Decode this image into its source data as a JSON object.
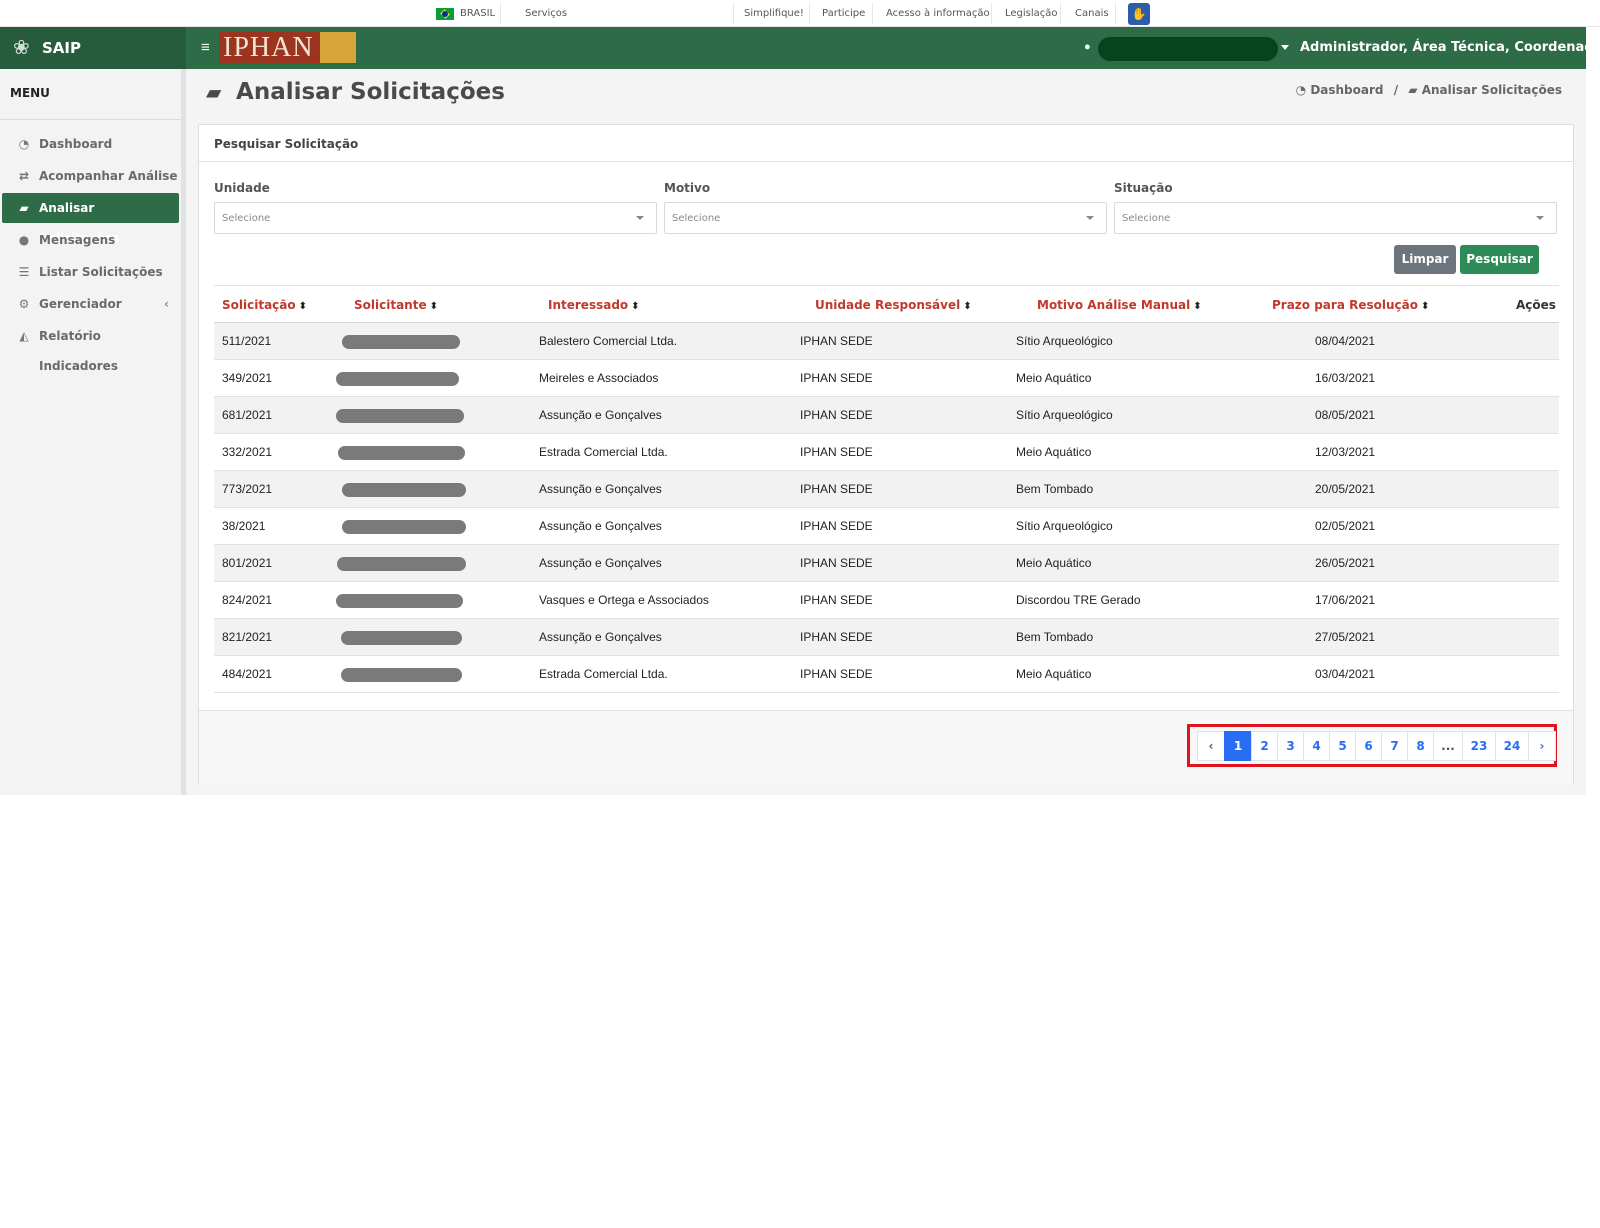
{
  "gov_bar": {
    "brasil": "BRASIL",
    "servicos": "Serviços",
    "links": [
      "Simplifique!",
      "Participe",
      "Acesso à informação",
      "Legislação",
      "Canais"
    ]
  },
  "header": {
    "app_name": "SAIP",
    "logo_text": "IPHAN",
    "user_role": "Administrador, Área Técnica, Coordenação..."
  },
  "sidebar": {
    "title": "MENU",
    "items": [
      {
        "label": "Dashboard",
        "icon": "dashboard-icon"
      },
      {
        "label": "Acompanhar Análise",
        "icon": "exchange-icon"
      },
      {
        "label": "Analisar Solicitações",
        "icon": "book-icon"
      },
      {
        "label": "Mensagens",
        "icon": "comments-icon"
      },
      {
        "label": "Listar Solicitações",
        "icon": "list-icon"
      },
      {
        "label": "Gerenciador",
        "icon": "cogs-icon"
      },
      {
        "label": "Relatório Indicadores",
        "icon": "area-chart-icon"
      }
    ],
    "active_index": 2
  },
  "page": {
    "title": "Analisar Solicitações",
    "breadcrumb": [
      "Dashboard",
      "Analisar Solicitações"
    ]
  },
  "search": {
    "panel_title": "Pesquisar Solicitação",
    "fields": [
      {
        "label": "Unidade",
        "placeholder": "Selecione"
      },
      {
        "label": "Motivo",
        "placeholder": "Selecione"
      },
      {
        "label": "Situação",
        "placeholder": "Selecione"
      }
    ],
    "clear_label": "Limpar",
    "search_label": "Pesquisar"
  },
  "table": {
    "columns": [
      "Solicitação",
      "Solicitante",
      "Interessado",
      "Unidade Responsável",
      "Motivo Análise Manual",
      "Prazo para Resolução",
      "Ações"
    ],
    "rows": [
      {
        "solicitacao": "511/2021",
        "interessado": "Balestero Comercial Ltda.",
        "unidade": "IPHAN SEDE",
        "motivo": "Sítio Arqueológico",
        "prazo": "08/04/2021"
      },
      {
        "solicitacao": "349/2021",
        "interessado": "Meireles e Associados",
        "unidade": "IPHAN SEDE",
        "motivo": "Meio Aquático",
        "prazo": "16/03/2021"
      },
      {
        "solicitacao": "681/2021",
        "interessado": "Assunção e Gonçalves",
        "unidade": "IPHAN SEDE",
        "motivo": "Sítio Arqueológico",
        "prazo": "08/05/2021"
      },
      {
        "solicitacao": "332/2021",
        "interessado": "Estrada Comercial Ltda.",
        "unidade": "IPHAN SEDE",
        "motivo": "Meio Aquático",
        "prazo": "12/03/2021"
      },
      {
        "solicitacao": "773/2021",
        "interessado": "Assunção e Gonçalves",
        "unidade": "IPHAN SEDE",
        "motivo": "Bem Tombado",
        "prazo": "20/05/2021"
      },
      {
        "solicitacao": "38/2021",
        "interessado": "Assunção e Gonçalves",
        "unidade": "IPHAN SEDE",
        "motivo": "Sítio Arqueológico",
        "prazo": "02/05/2021"
      },
      {
        "solicitacao": "801/2021",
        "interessado": "Assunção e Gonçalves",
        "unidade": "IPHAN SEDE",
        "motivo": "Meio Aquático",
        "prazo": "26/05/2021"
      },
      {
        "solicitacao": "824/2021",
        "interessado": "Vasques e Ortega e Associados",
        "unidade": "IPHAN SEDE",
        "motivo": "Discordou TRE Gerado",
        "prazo": "17/06/2021"
      },
      {
        "solicitacao": "821/2021",
        "interessado": "Assunção e Gonçalves",
        "unidade": "IPHAN SEDE",
        "motivo": "Bem Tombado",
        "prazo": "27/05/2021"
      },
      {
        "solicitacao": "484/2021",
        "interessado": "Estrada Comercial Ltda.",
        "unidade": "IPHAN SEDE",
        "motivo": "Meio Aquático",
        "prazo": "03/04/2021"
      }
    ]
  },
  "pagination": {
    "prev": "‹",
    "pages": [
      "1",
      "2",
      "3",
      "4",
      "5",
      "6",
      "7",
      "8",
      "...",
      "23",
      "24"
    ],
    "next": "›",
    "current": "1"
  },
  "colors": {
    "header_green": "#2e6b47",
    "active_green": "#2e6b47",
    "link_red": "#c0392b",
    "pager_blue": "#2a6df5",
    "highlight_red": "#e0141e"
  }
}
